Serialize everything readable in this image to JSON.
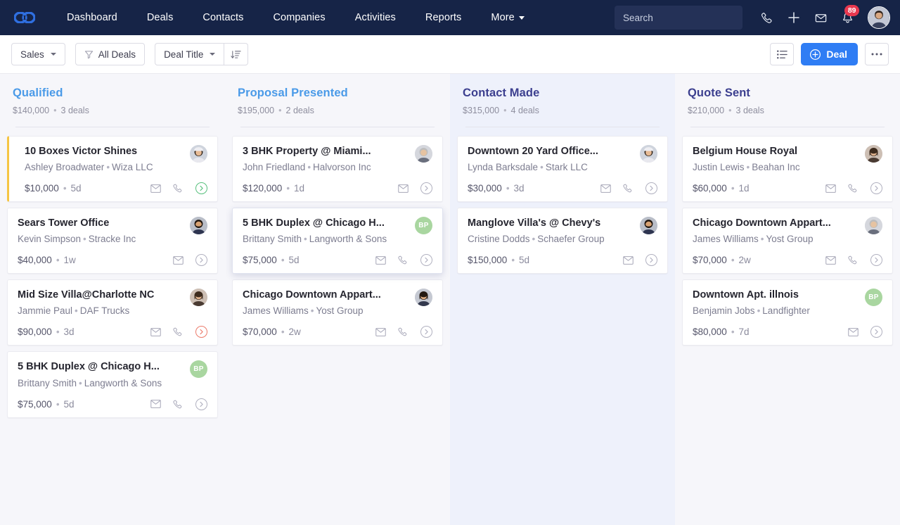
{
  "navbar": {
    "brand_icon": "chain-link-logo",
    "links": [
      {
        "label": "Dashboard",
        "name": "nav-dashboard"
      },
      {
        "label": "Deals",
        "name": "nav-deals"
      },
      {
        "label": "Contacts",
        "name": "nav-contacts"
      },
      {
        "label": "Companies",
        "name": "nav-companies"
      },
      {
        "label": "Activities",
        "name": "nav-activities"
      },
      {
        "label": "Reports",
        "name": "nav-reports"
      }
    ],
    "more_label": "More",
    "search": {
      "placeholder": "Search",
      "value": ""
    },
    "icons": [
      "phone-icon",
      "plus-icon",
      "envelope-icon",
      "bell-icon"
    ],
    "notification_count": "89"
  },
  "toolbar": {
    "pipeline_label": "Sales",
    "filter_label": "All Deals",
    "sort_field_label": "Deal Title",
    "sort_dir_icon": "sort-descending-icon",
    "list_view_icon": "list-view-icon",
    "add_deal_label": "Deal",
    "more_options_icon": "ellipsis-icon",
    "accent_color": "#2f7df4"
  },
  "board": {
    "columns": [
      {
        "title": "Qualified",
        "amount": "$140,000",
        "deal_count": "3 deals",
        "title_color": "#4a9ae8",
        "highlighted": false,
        "cards": [
          {
            "title": "10 Boxes Victor Shines",
            "contact": "Ashley Broadwater",
            "company": "Wiza LLC",
            "amount": "$10,000",
            "age": "5d",
            "avatar_type": "photo",
            "avatar_initials": "",
            "accent": true,
            "has_email": true,
            "has_phone": true,
            "arrow_state": "green"
          },
          {
            "title": "Sears Tower Office",
            "contact": "Kevin Simpson",
            "company": "Stracke Inc",
            "amount": "$40,000",
            "age": "1w",
            "avatar_type": "photo",
            "avatar_initials": "",
            "accent": false,
            "has_email": true,
            "has_phone": false,
            "arrow_state": "gray"
          },
          {
            "title": "Mid Size Villa@Charlotte NC",
            "contact": "Jammie Paul",
            "company": "DAF Trucks",
            "amount": "$90,000",
            "age": "3d",
            "avatar_type": "photo",
            "avatar_initials": "",
            "accent": false,
            "has_email": true,
            "has_phone": true,
            "arrow_state": "red"
          },
          {
            "title": "5 BHK Duplex @ Chicago H...",
            "contact": "Brittany Smith",
            "company": "Langworth & Sons",
            "amount": "$75,000",
            "age": "5d",
            "avatar_type": "initials",
            "avatar_initials": "BP",
            "accent": false,
            "has_email": true,
            "has_phone": true,
            "arrow_state": "gray"
          }
        ]
      },
      {
        "title": "Proposal Presented",
        "amount": "$195,000",
        "deal_count": "2 deals",
        "title_color": "#4a9ae8",
        "highlighted": false,
        "cards": [
          {
            "title": "3 BHK Property @ Miami...",
            "contact": "John Friedland",
            "company": "Halvorson Inc",
            "amount": "$120,000",
            "age": "1d",
            "avatar_type": "photo",
            "avatar_initials": "",
            "accent": false,
            "has_email": true,
            "has_phone": false,
            "arrow_state": "gray"
          },
          {
            "title": "5 BHK Duplex @ Chicago H...",
            "contact": "Brittany Smith",
            "company": "Langworth & Sons",
            "amount": "$75,000",
            "age": "5d",
            "avatar_type": "initials",
            "avatar_initials": "BP",
            "accent": false,
            "has_email": true,
            "has_phone": true,
            "arrow_state": "gray",
            "lifted": true
          },
          {
            "title": "Chicago Downtown Appart...",
            "contact": "James Williams",
            "company": "Yost Group",
            "amount": "$70,000",
            "age": "2w",
            "avatar_type": "photo",
            "avatar_initials": "",
            "accent": false,
            "has_email": true,
            "has_phone": true,
            "arrow_state": "gray"
          }
        ]
      },
      {
        "title": "Contact Made",
        "amount": "$315,000",
        "deal_count": "4 deals",
        "title_color": "#3c3f8f",
        "highlighted": true,
        "cards": [
          {
            "title": "Downtown 20 Yard Office...",
            "contact": "Lynda Barksdale",
            "company": "Stark LLC",
            "amount": "$30,000",
            "age": "3d",
            "avatar_type": "photo",
            "avatar_initials": "",
            "accent": false,
            "has_email": true,
            "has_phone": true,
            "arrow_state": "gray"
          },
          {
            "title": "Manglove Villa's @ Chevy's",
            "contact": "Cristine Dodds",
            "company": "Schaefer Group",
            "amount": "$150,000",
            "age": "5d",
            "avatar_type": "photo",
            "avatar_initials": "",
            "accent": false,
            "has_email": true,
            "has_phone": false,
            "arrow_state": "gray"
          }
        ]
      },
      {
        "title": "Quote Sent",
        "amount": "$210,000",
        "deal_count": "3 deals",
        "title_color": "#3c3f8f",
        "highlighted": false,
        "cards": [
          {
            "title": "Belgium House Royal",
            "contact": "Justin Lewis",
            "company": "Beahan Inc",
            "amount": "$60,000",
            "age": "1d",
            "avatar_type": "photo",
            "avatar_initials": "",
            "accent": false,
            "has_email": true,
            "has_phone": true,
            "arrow_state": "gray"
          },
          {
            "title": "Chicago Downtown Appart...",
            "contact": "James Williams",
            "company": "Yost Group",
            "amount": "$70,000",
            "age": "2w",
            "avatar_type": "photo",
            "avatar_initials": "",
            "accent": false,
            "has_email": true,
            "has_phone": true,
            "arrow_state": "gray"
          },
          {
            "title": "Downtown Apt. illnois",
            "contact": "Benjamin Jobs",
            "company": "Landfighter",
            "amount": "$80,000",
            "age": "7d",
            "avatar_type": "initials",
            "avatar_initials": "BP",
            "accent": false,
            "has_email": true,
            "has_phone": false,
            "arrow_state": "gray"
          }
        ]
      }
    ]
  }
}
